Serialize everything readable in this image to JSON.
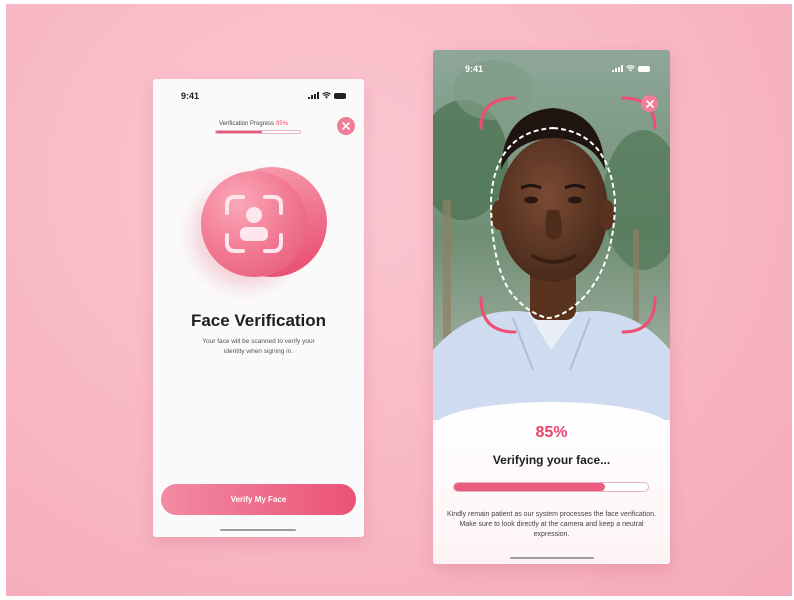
{
  "screen1": {
    "status_time": "9:41",
    "progress_label": "Verification Progress",
    "progress_percent": "85%",
    "progress_value": 0.55,
    "title": "Face Verification",
    "subtitle": "Your face will be scanned to verify your identity when signing in.",
    "button_label": "Verify My Face",
    "icon_name": "face-scan-icon"
  },
  "screen2": {
    "status_time": "9:41",
    "percent": "85%",
    "title": "Verifying your face...",
    "progress_value": 0.78,
    "note": "Kindly remain patient as our system processes the face verification. Make sure to look directly at the camera and keep a neutral expression."
  },
  "colors": {
    "accent": "#e9587a",
    "background": "#f8b7c4"
  }
}
